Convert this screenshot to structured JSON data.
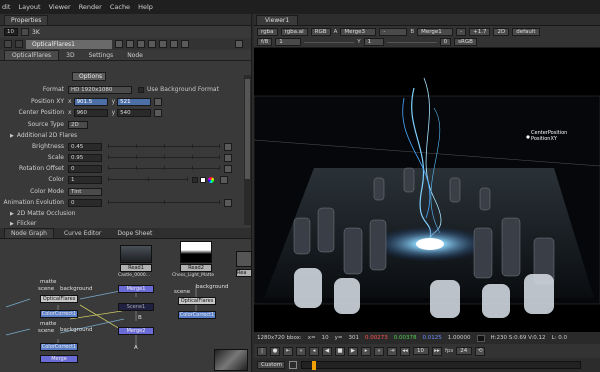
{
  "menubar": {
    "items": [
      "dit",
      "Layout",
      "Viewer",
      "Render",
      "Cache",
      "Help"
    ]
  },
  "properties": {
    "tab_label": "Properties",
    "max_panels": "10",
    "node_name": "OpticalFlares1",
    "subtabs": [
      "OpticalFlares",
      "3D",
      "Settings",
      "Node"
    ],
    "options_button": "Options",
    "format": {
      "label": "Format",
      "value": "HD 1920x1080",
      "checkbox_label": "Use Background Format"
    },
    "position_xy": {
      "label": "Position XY",
      "x_label": "x",
      "x": "901.5",
      "y_label": "y",
      "y": "521"
    },
    "center_position": {
      "label": "Center Position",
      "x_label": "x",
      "x": "960",
      "y_label": "y",
      "y": "540"
    },
    "source_type": {
      "label": "Source Type",
      "value": "2D"
    },
    "additional_flares": "Additional 2D Flares",
    "brightness": {
      "label": "Brightness",
      "value": "0.45"
    },
    "scale": {
      "label": "Scale",
      "value": "0.95"
    },
    "rotation_offset": {
      "label": "Rotation Offset",
      "value": "0"
    },
    "color": {
      "label": "Color",
      "value": "1"
    },
    "color_mode": {
      "label": "Color Mode",
      "value": "Tint"
    },
    "animation_evolution": {
      "label": "Animation Evolution",
      "value": "0"
    },
    "matte_occlusion": "2D Matte Occlusion",
    "flicker": "Flicker"
  },
  "nodegraph": {
    "tabs": [
      "Node Graph",
      "Curve Editor",
      "Dope Sheet"
    ],
    "nodes": {
      "read1": "Read1",
      "read1_sub": "Castle_0000...",
      "read2": "Read2",
      "read2_sub": "Chess_Light_Matte",
      "read3": "Rea",
      "opticalflares": "OpticalFlares",
      "colorcorrect1": "ColorCorrect1",
      "merge1": "Merge1",
      "scene1": "Scene1",
      "opticalflares2": "OpticalFlares",
      "colorcorrect2": "ColorCorrect1",
      "merge2": "Merge2",
      "colorcorrect3": "ColorCorrect1",
      "merge3": "Merge"
    },
    "labels": {
      "matte": "matte",
      "scene": "scene",
      "background": "background",
      "b_in": "B",
      "a_in": "A"
    }
  },
  "viewer": {
    "tab_label": "Viewer1",
    "toolbar1": {
      "channels": "rgba",
      "layer": "rgba.al",
      "display": "RGB",
      "a_label": "A",
      "a_input": "Merge3",
      "dash": "-",
      "b_label": "B",
      "b_input": "Merge1",
      "dash2": "-",
      "gain": "+1.7",
      "view": "2D",
      "lut": "default"
    },
    "toolbar2": {
      "f_label": "f/8",
      "one": "1",
      "y_label": "Y",
      "one2": "1",
      "zero": "0",
      "srgb": "sRGB"
    },
    "overlay": {
      "center_position": "CenterPosition",
      "position_xy": "PositionXY"
    },
    "status": {
      "res": "1280x720 bbox:",
      "x": "x=",
      "x_val": "10",
      "y": "y=",
      "y_val": "301",
      "r": "0.00273",
      "g": "0.00378",
      "b": "0.0125",
      "a": "1.00000",
      "hsv": "H:230 S:0.69 V:0.12",
      "l": "L: 0.0"
    },
    "transport": {
      "frame": "10",
      "fps_label": "fps",
      "fps": "24"
    },
    "timeline": {
      "range_mode": "Custom"
    }
  }
}
